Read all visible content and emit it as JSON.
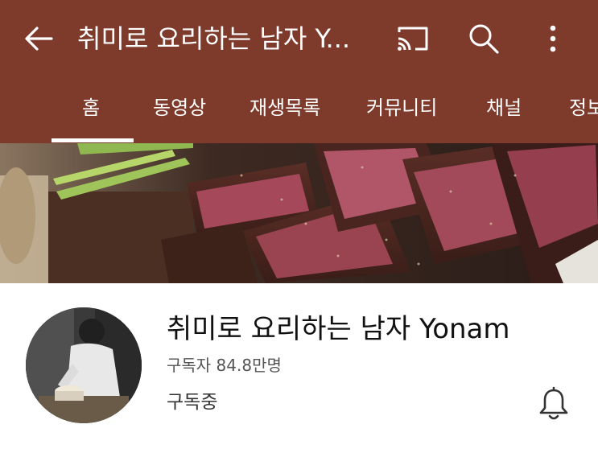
{
  "colors": {
    "header_bg": "#7e3a2b",
    "header_fg": "#ffffff",
    "page_bg": "#ffffff",
    "title_text": "#111111",
    "secondary_text": "#555555"
  },
  "header": {
    "title": "취미로 요리하는 남자 Y...",
    "icons": [
      "back-arrow-icon",
      "cast-icon",
      "search-icon",
      "more-vertical-icon"
    ]
  },
  "tabs": [
    {
      "label": "홈",
      "selected": true
    },
    {
      "label": "동영상",
      "selected": false
    },
    {
      "label": "재생목록",
      "selected": false
    },
    {
      "label": "커뮤니티",
      "selected": false
    },
    {
      "label": "채널",
      "selected": false
    },
    {
      "label": "정보",
      "selected": false
    }
  ],
  "channel": {
    "name": "취미로 요리하는 남자 Yonam",
    "subscribers": "구독자 84.8만명",
    "subscribe_status": "구독중",
    "notification_icon": "bell-icon"
  }
}
